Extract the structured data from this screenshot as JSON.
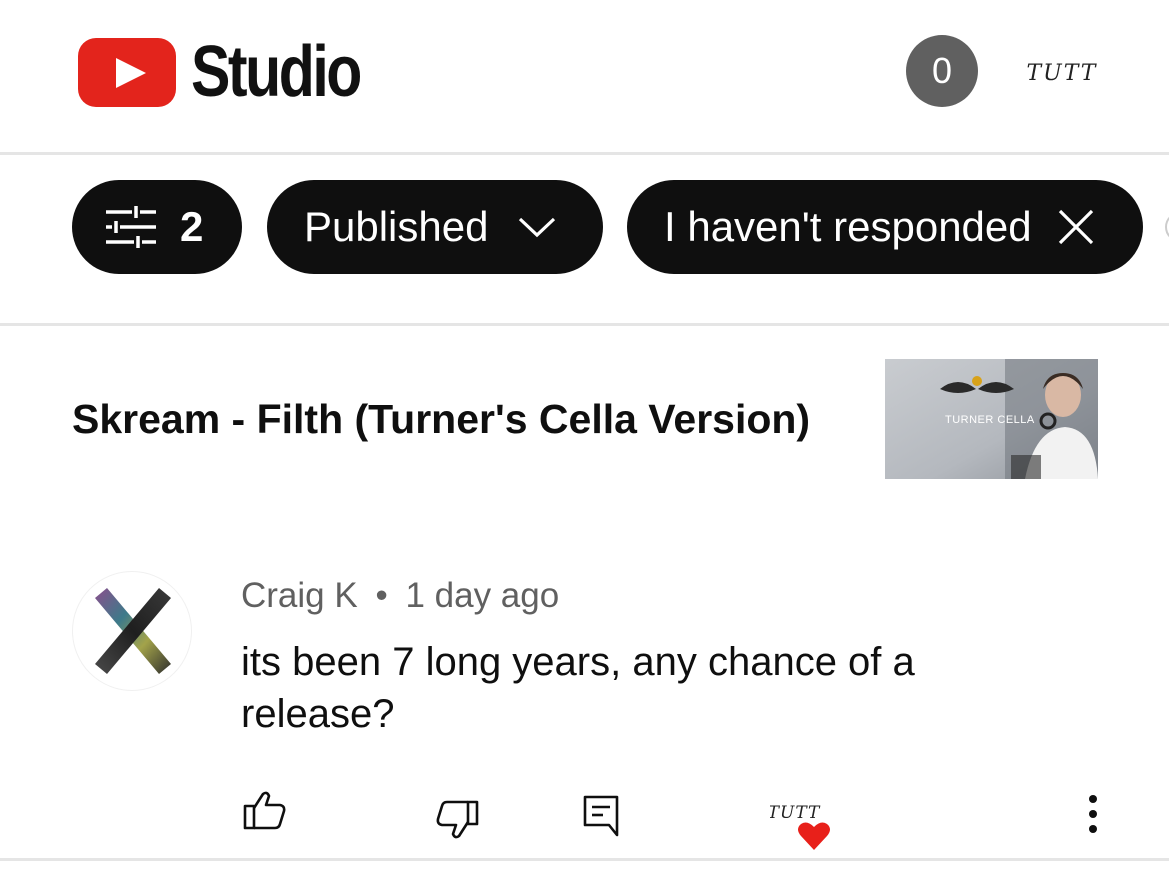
{
  "header": {
    "app_name": "Studio",
    "notification_count": "0",
    "account_logo_text": "TUTT"
  },
  "filters": {
    "filter_count": "2",
    "published_label": "Published",
    "responded_label": "I haven't responded"
  },
  "video": {
    "title": "Skream - Filth (Turner's Cella Version)",
    "thumbnail_text": "TURNER CELLA"
  },
  "comment": {
    "author": "Craig K",
    "separator": "•",
    "time": "1 day ago",
    "text": "its been 7 long years, any chance of a release?"
  },
  "actions": {
    "heart_label_text": "TUTT",
    "icons": [
      "thumb-up-icon",
      "thumb-down-icon",
      "reply-icon",
      "creator-heart-icon",
      "more-vert-icon"
    ]
  },
  "colors": {
    "youtube_red": "#e3241c",
    "chip_bg": "#0f0f0f",
    "secondary_text": "#606060",
    "heart_red": "#e8201a"
  }
}
